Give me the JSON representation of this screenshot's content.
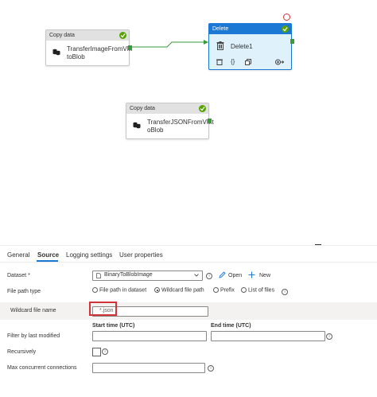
{
  "canvas": {
    "activity1": {
      "type_label": "Copy data",
      "name_line1": "TransferImageFromVM",
      "name_line2": "toBlob"
    },
    "activity2": {
      "type_label": "Delete",
      "name": "Delete1"
    },
    "activity3": {
      "type_label": "Copy data",
      "name_line1": "TransferJSONFromVMt",
      "name_line2": "oBlob"
    }
  },
  "tabs": [
    "General",
    "Source",
    "Logging settings",
    "User properties"
  ],
  "active_tab": "Source",
  "source": {
    "dataset_label": "Dataset",
    "dataset_required": "*",
    "dataset_value": "BinaryToBlobImage",
    "open_label": "Open",
    "new_label": "New",
    "file_path_type_label": "File path type",
    "radio_options": [
      "File path in dataset",
      "Wildcard file path",
      "Prefix",
      "List of files"
    ],
    "radio_selected": "Wildcard file path",
    "wildcard_label": "Wildcard file name",
    "wildcard_value": "*.json",
    "filter_label": "Filter by last modified",
    "start_time_label": "Start time (UTC)",
    "end_time_label": "End time (UTC)",
    "recursively_label": "Recursively",
    "max_conn_label": "Max concurrent connections"
  },
  "colors": {
    "accent": "#1b78d4",
    "success": "#57a300",
    "highlight": "#d13438",
    "selected_bg": "#dff1fb"
  }
}
